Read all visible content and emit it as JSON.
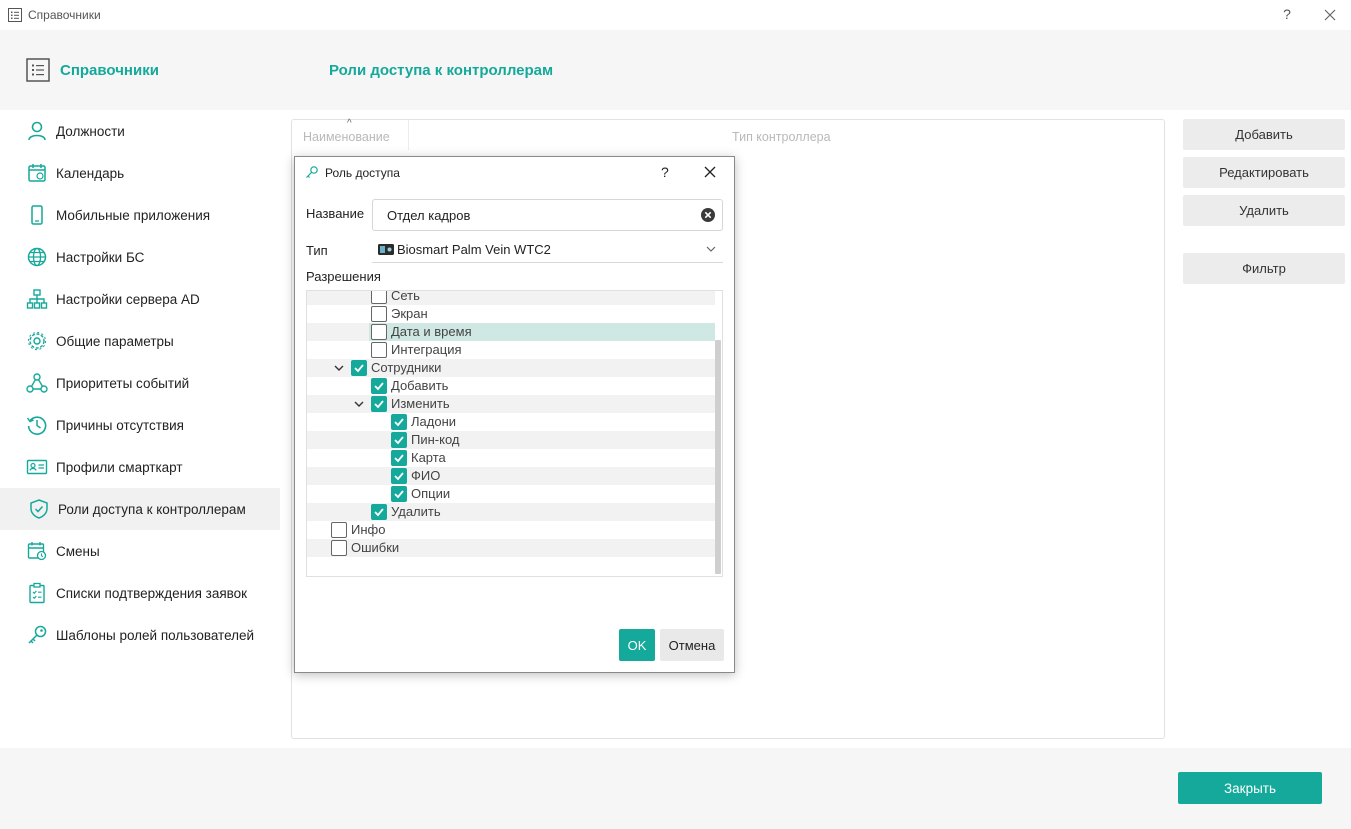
{
  "window": {
    "title": "Справочники",
    "help": "?"
  },
  "header": {
    "title": "Справочники",
    "page_title": "Роли доступа к контроллерам"
  },
  "sidebar": {
    "items": [
      {
        "label": "Должности"
      },
      {
        "label": "Календарь"
      },
      {
        "label": "Мобильные приложения"
      },
      {
        "label": "Настройки БС"
      },
      {
        "label": "Настройки сервера AD"
      },
      {
        "label": "Общие параметры"
      },
      {
        "label": "Приоритеты событий"
      },
      {
        "label": "Причины отсутствия"
      },
      {
        "label": "Профили смарткарт"
      },
      {
        "label": "Роли доступа к контроллерам",
        "active": true
      },
      {
        "label": "Смены"
      },
      {
        "label": "Списки подтверждения заявок"
      },
      {
        "label": "Шаблоны ролей пользователей"
      }
    ]
  },
  "grid": {
    "col_name": "Наименование",
    "col_type": "Тип контроллера"
  },
  "actions": {
    "add": "Добавить",
    "edit": "Редактировать",
    "delete": "Удалить",
    "filter": "Фильтр"
  },
  "footer": {
    "close": "Закрыть"
  },
  "dialog": {
    "title": "Роль доступа",
    "help": "?",
    "name_label": "Название",
    "name_value": "Отдел кадров",
    "type_label": "Тип",
    "type_value": "Biosmart Palm Vein WTC2",
    "permissions_label": "Разрешения",
    "tree": [
      {
        "label": "Сеть",
        "checked": false
      },
      {
        "label": "Экран",
        "checked": false
      },
      {
        "label": "Дата и время",
        "checked": false,
        "selected": true
      },
      {
        "label": "Интеграция",
        "checked": false
      },
      {
        "label": "Сотрудники",
        "checked": true,
        "expanded": true
      },
      {
        "label": "Добавить",
        "checked": true
      },
      {
        "label": "Изменить",
        "checked": true,
        "expanded": true
      },
      {
        "label": "Ладони",
        "checked": true
      },
      {
        "label": "Пин-код",
        "checked": true
      },
      {
        "label": "Карта",
        "checked": true
      },
      {
        "label": "ФИО",
        "checked": true
      },
      {
        "label": "Опции",
        "checked": true
      },
      {
        "label": "Удалить",
        "checked": true
      },
      {
        "label": "Инфо",
        "checked": false
      },
      {
        "label": "Ошибки",
        "checked": false
      }
    ],
    "ok": "OK",
    "cancel": "Отмена"
  },
  "colors": {
    "accent": "#14a99a",
    "selection": "#cfe8e4"
  }
}
